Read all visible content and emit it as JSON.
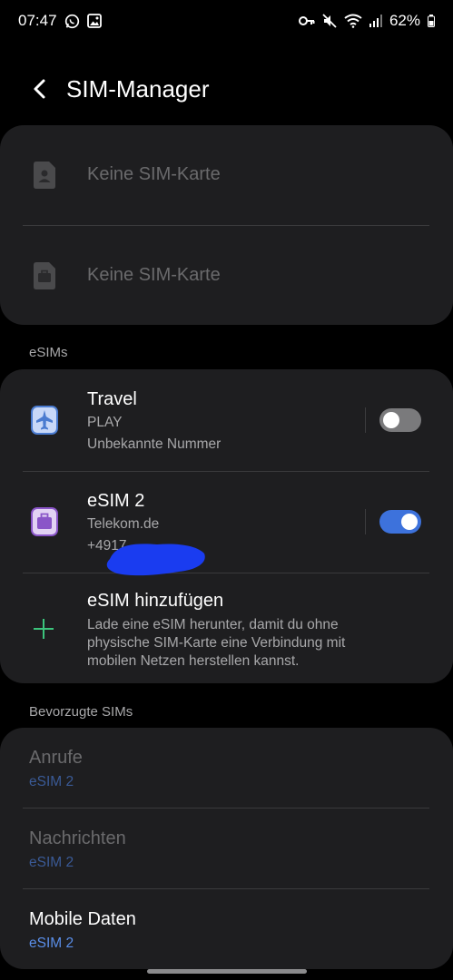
{
  "status_bar": {
    "time": "07:47",
    "battery": "62%",
    "left_icons": [
      "whatsapp-icon",
      "gallery-icon"
    ],
    "right_icons": [
      "key-icon",
      "mute-icon",
      "wifi-icon",
      "signal-icon",
      "battery-icon"
    ]
  },
  "header": {
    "title": "SIM-Manager",
    "back_icon": "back-arrow-icon"
  },
  "physical_sims": [
    {
      "label": "Keine SIM-Karte",
      "icon": "sim-person-icon"
    },
    {
      "label": "Keine SIM-Karte",
      "icon": "sim-briefcase-icon"
    }
  ],
  "esims_section": {
    "title": "eSIMs",
    "items": [
      {
        "name": "Travel",
        "carrier": "PLAY",
        "number": "Unbekannte Nummer",
        "enabled": false,
        "icon": "airplane-icon",
        "icon_color": "#4a7bd0"
      },
      {
        "name": "eSIM 2",
        "carrier": "Telekom.de",
        "number": "+4917",
        "enabled": true,
        "icon": "briefcase-icon",
        "icon_color": "#8a55c8"
      }
    ],
    "add": {
      "title": "eSIM hinzufügen",
      "description": "Lade eine eSIM herunter, damit du ohne physische SIM-Karte eine Verbindung mit mobilen Netzen herstellen kannst.",
      "icon": "plus-icon"
    }
  },
  "preferred_section": {
    "title": "Bevorzugte SIMs",
    "items": [
      {
        "label": "Anrufe",
        "value": "eSIM 2",
        "enabled": false
      },
      {
        "label": "Nachrichten",
        "value": "eSIM 2",
        "enabled": false
      },
      {
        "label": "Mobile Daten",
        "value": "eSIM 2",
        "enabled": true
      }
    ]
  },
  "colors": {
    "accent_blue": "#3d72dc",
    "plus_green": "#3cc47c",
    "card_bg": "#1e1e20",
    "redaction_blue": "#1a3cf0"
  }
}
